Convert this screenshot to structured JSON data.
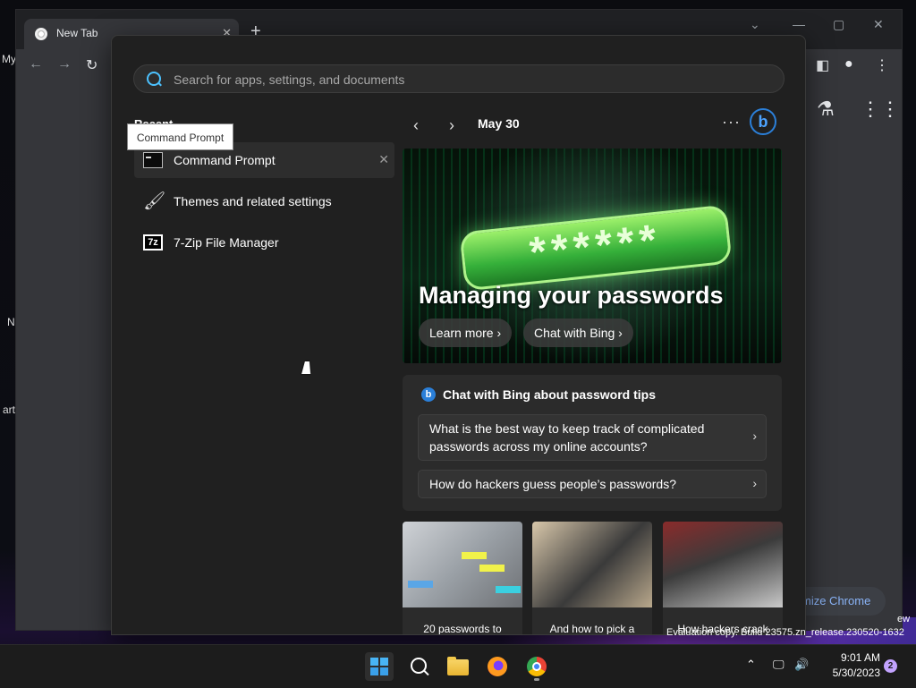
{
  "desktop": {
    "fragments": [
      "My",
      "N",
      "art"
    ]
  },
  "chrome": {
    "tab_title": "New Tab",
    "tab_close": "✕",
    "new_tab": "+",
    "customize_label": "mize Chrome"
  },
  "search": {
    "placeholder": "Search for apps, settings, and documents",
    "value": ""
  },
  "recent": {
    "heading": "Recent",
    "tooltip": "Command Prompt",
    "items": [
      {
        "label": "Command Prompt",
        "icon": "command-prompt-icon"
      },
      {
        "label": "Themes and related settings",
        "icon": "paintbrush-icon"
      },
      {
        "label": "7-Zip File Manager",
        "icon": "7zip-icon",
        "icon_text": "7z"
      }
    ]
  },
  "highlights": {
    "date": "May 30",
    "more": "···",
    "bing_letter": "b",
    "hero": {
      "password_text": "******",
      "title": "Managing your passwords",
      "buttons": [
        "Learn more",
        "Chat with Bing"
      ]
    },
    "chat": {
      "title": "Chat with Bing about password tips",
      "questions": [
        "What is the best way to keep track of complicated passwords across my online accounts?",
        "How do hackers guess people’s passwords?"
      ]
    },
    "thumbnails": [
      {
        "caption": "20 passwords to"
      },
      {
        "caption": "And how to pick a"
      },
      {
        "caption": "How hackers crack"
      }
    ]
  },
  "watermark": {
    "text": "Evaluation copy. Build 23575.zn_release.230520-1632",
    "fragment": "ew"
  },
  "taskbar": {
    "time": "9:01 AM",
    "date": "5/30/2023",
    "notifications": "2",
    "running_app": "chrome"
  },
  "colors": {
    "accent": "#4cc2ff",
    "panel_bg": "#202020",
    "bing_blue": "#2b7fd8"
  }
}
